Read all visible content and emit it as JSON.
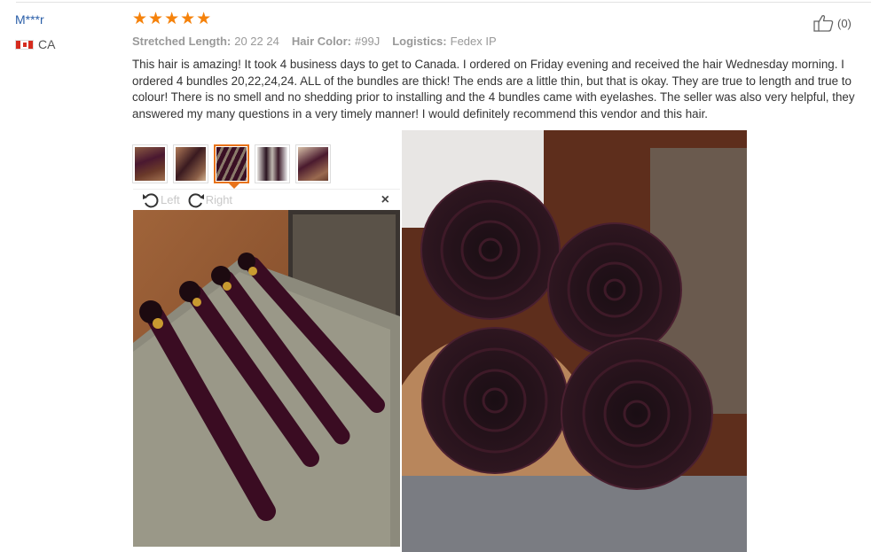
{
  "reviewer": {
    "name": "M***r",
    "country_code": "CA",
    "flag_colors": {
      "red": "#d52b1e",
      "white": "#ffffff"
    }
  },
  "rating": {
    "stars": 5,
    "glyphs": "★★★★★",
    "color": "#f5820b"
  },
  "meta": {
    "length_label": "Stretched Length:",
    "length_value": "20 22 24",
    "color_label": "Hair Color:",
    "color_value": "#99J",
    "logistics_label": "Logistics:",
    "logistics_value": "Fedex IP"
  },
  "helpful": {
    "icon": "thumbs-up-icon",
    "count": "(0)"
  },
  "review_text": "This hair is amazing! It took 4 business days to get to Canada. I ordered on Friday evening and received the hair Wednesday morning. I ordered 4 bundles 20,22,24,24. ALL of the bundles are thick! The ends are a little thin, but that is okay. They are true to length and true to colour! There is no smell and no shedding prior to installing and the 4 bundles came with eyelashes. The seller was also very helpful, they answered my many questions in a very timely manner! I would definitely recommend this vendor and this hair.",
  "thumbnails": [
    {
      "icon": "photo-thumbnail",
      "active": false
    },
    {
      "icon": "photo-thumbnail",
      "active": false
    },
    {
      "icon": "photo-thumbnail",
      "active": true
    },
    {
      "icon": "photo-thumbnail",
      "active": false
    },
    {
      "icon": "photo-thumbnail",
      "active": false
    }
  ],
  "viewer": {
    "rotate_left_label": "Left",
    "rotate_right_label": "Right",
    "close_glyph": "×",
    "accent_color": "#e8731a"
  }
}
